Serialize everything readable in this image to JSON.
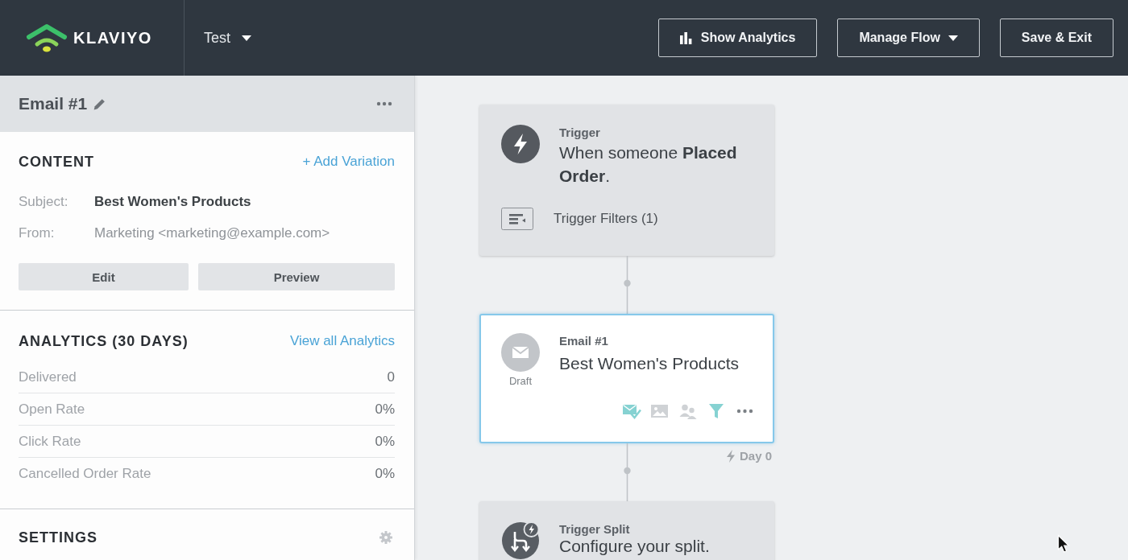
{
  "header": {
    "logo": "KLAVIYO",
    "flow_name": "Test",
    "buttons": [
      {
        "label": "Show Analytics",
        "kind": "analytics"
      },
      {
        "label": "Manage Flow",
        "kind": "menu"
      },
      {
        "label": "Save & Exit",
        "kind": "exit"
      }
    ]
  },
  "sidebar": {
    "title": "Email #1",
    "content": {
      "heading": "CONTENT",
      "action": "+ Add Variation",
      "fields": [
        {
          "label": "Subject:",
          "value": "Best Women's Products",
          "kind": "primary"
        },
        {
          "label": "From:",
          "value": "Marketing <marketing@example.com>",
          "kind": "secondary"
        }
      ],
      "buttons": [
        "Edit",
        "Preview"
      ]
    },
    "analytics": {
      "heading": "ANALYTICS (30 DAYS)",
      "link": "View all Analytics",
      "rows": [
        {
          "label": "Delivered",
          "value": "0"
        },
        {
          "label": "Open Rate",
          "value": "0%"
        },
        {
          "label": "Click Rate",
          "value": "0%"
        },
        {
          "label": "Cancelled Order Rate",
          "value": "0%"
        }
      ]
    },
    "settings": {
      "heading": "SETTINGS"
    }
  },
  "flow": {
    "nodes": [
      {
        "kind": "trigger",
        "selected": false,
        "label": "Trigger",
        "text": "When someone **Placed Order**.",
        "filter": "Trigger Filters (1)"
      },
      {
        "kind": "email",
        "selected": true,
        "label": "Email #1",
        "text": "Best Women's Products",
        "status": "Draft",
        "tools": [
          {
            "kind": "content",
            "active": true
          },
          {
            "kind": "images",
            "active": false
          },
          {
            "kind": "people",
            "active": false
          },
          {
            "kind": "filter",
            "active": true
          }
        ],
        "delay": "Day 0"
      },
      {
        "kind": "split",
        "selected": false,
        "label": "Trigger Split",
        "text": "Configure your split."
      }
    ]
  }
}
